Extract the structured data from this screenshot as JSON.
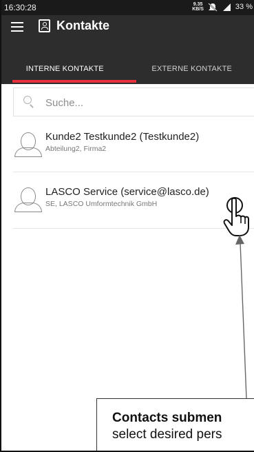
{
  "status_bar": {
    "time": "16:30:28",
    "speed_value": "9.35",
    "speed_unit": "KB/S",
    "battery": "33 %"
  },
  "toolbar": {
    "menu_icon": "hamburger-menu-icon",
    "title_icon": "contacts-icon",
    "title": "Kontakte"
  },
  "tabs": [
    {
      "label": "INTERNE KONTAKTE",
      "active": true
    },
    {
      "label": "EXTERNE KONTAKTE",
      "active": false
    }
  ],
  "accent_color": "#e8313c",
  "search": {
    "placeholder": "Suche..."
  },
  "contacts": [
    {
      "name": "Kunde2 Testkunde2 (Testkunde2)",
      "details": "Abteilung2, Firma2"
    },
    {
      "name": "LASCO Service (service@lasco.de)",
      "details": "SE, LASCO Umformtechnik GmbH"
    }
  ],
  "annotation": {
    "title": "Contacts submen",
    "text": "select desired pers"
  }
}
